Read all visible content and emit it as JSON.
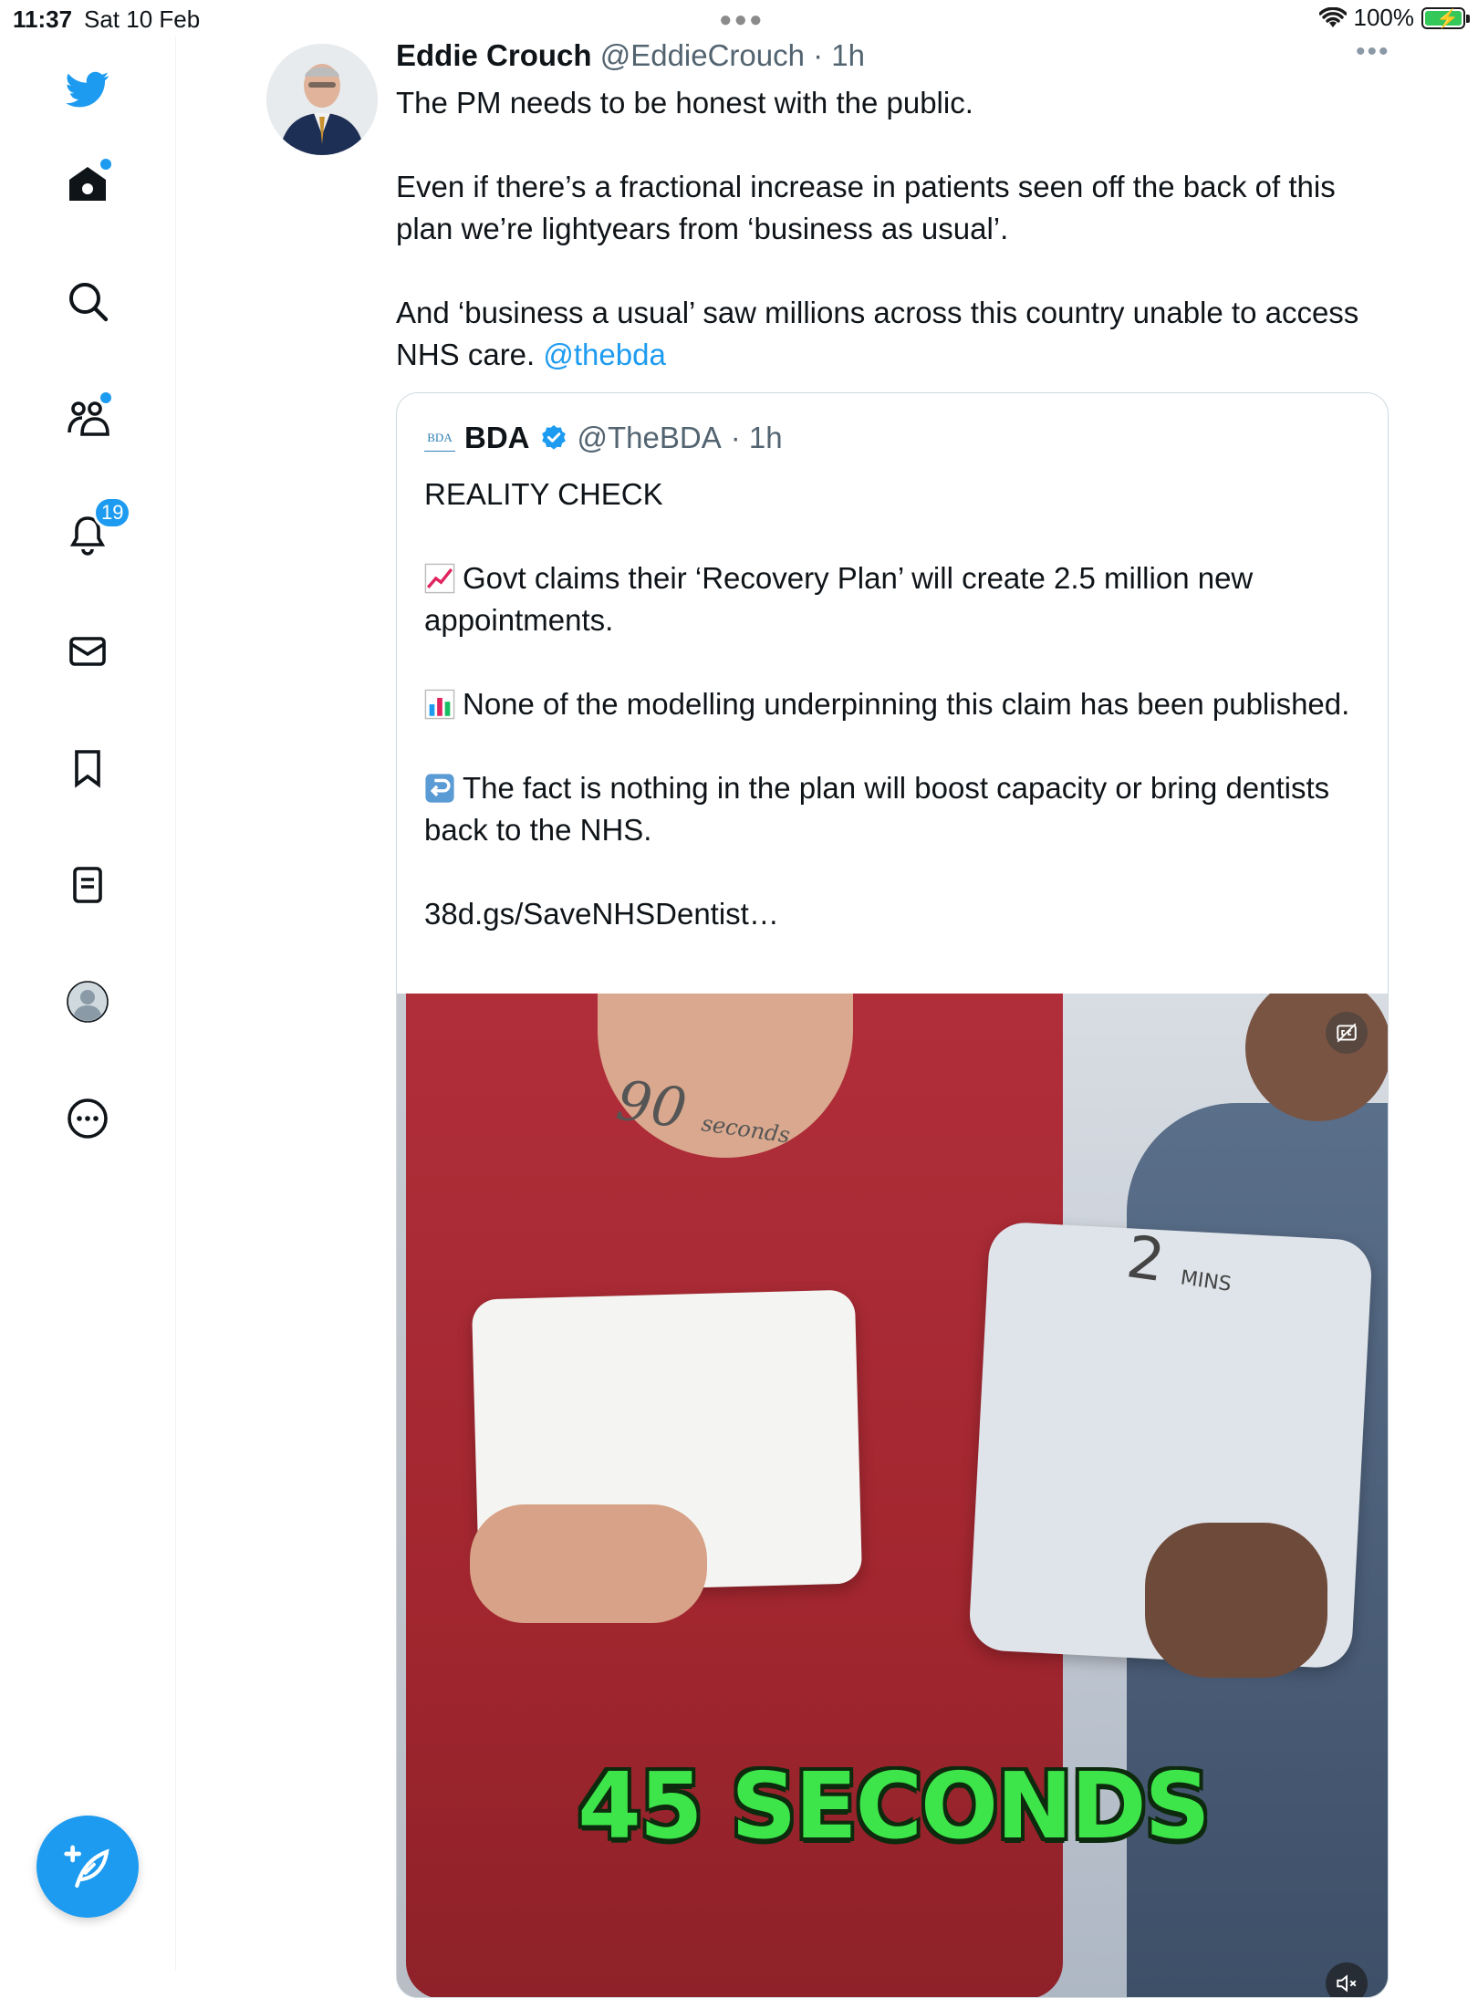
{
  "status_bar": {
    "time": "11:37",
    "date": "Sat 10 Feb",
    "battery_percent": "100%"
  },
  "sidebar": {
    "items": [
      {
        "name": "twitter-logo"
      },
      {
        "name": "home"
      },
      {
        "name": "explore"
      },
      {
        "name": "communities"
      },
      {
        "name": "notifications",
        "badge": "19"
      },
      {
        "name": "messages"
      },
      {
        "name": "bookmarks"
      },
      {
        "name": "lists"
      },
      {
        "name": "profile"
      },
      {
        "name": "more"
      }
    ],
    "accent_color": "#1d9bf0"
  },
  "tweet": {
    "author_name": "Eddie Crouch",
    "author_handle": "@EddieCrouch",
    "time_meta": " · 1h",
    "text": {
      "p1": "The PM needs to be honest with the public.",
      "p2": "Even if there’s a fractional increase in patients seen off the back of this plan we’re lightyears from ‘business as usual’.",
      "p3": "And ‘business a usual’ saw millions across this country unable to access NHS care. ",
      "mention": " @thebda"
    }
  },
  "quoted_tweet": {
    "logo_text": "BDA",
    "author_name": "BDA",
    "author_handle": "@TheBDA",
    "time_meta": " · 1h",
    "text": {
      "p1": "REALITY CHECK",
      "p2": "Govt claims their ‘Recovery Plan’ will create 2.5 million new appointments.",
      "p3": "None of the modelling underpinning this claim has been published.",
      "p4": "The fact is nothing in the plan will boost capacity or bring dentists back to the NHS.",
      "link": "38d.gs/SaveNHSDentist…"
    },
    "media": {
      "board_left_text": "90",
      "board_left_small": "seconds",
      "board_right_text": "2",
      "board_right_small": "MINS",
      "caption": "45 SECONDS",
      "caption_color": "#3ee54a"
    }
  }
}
